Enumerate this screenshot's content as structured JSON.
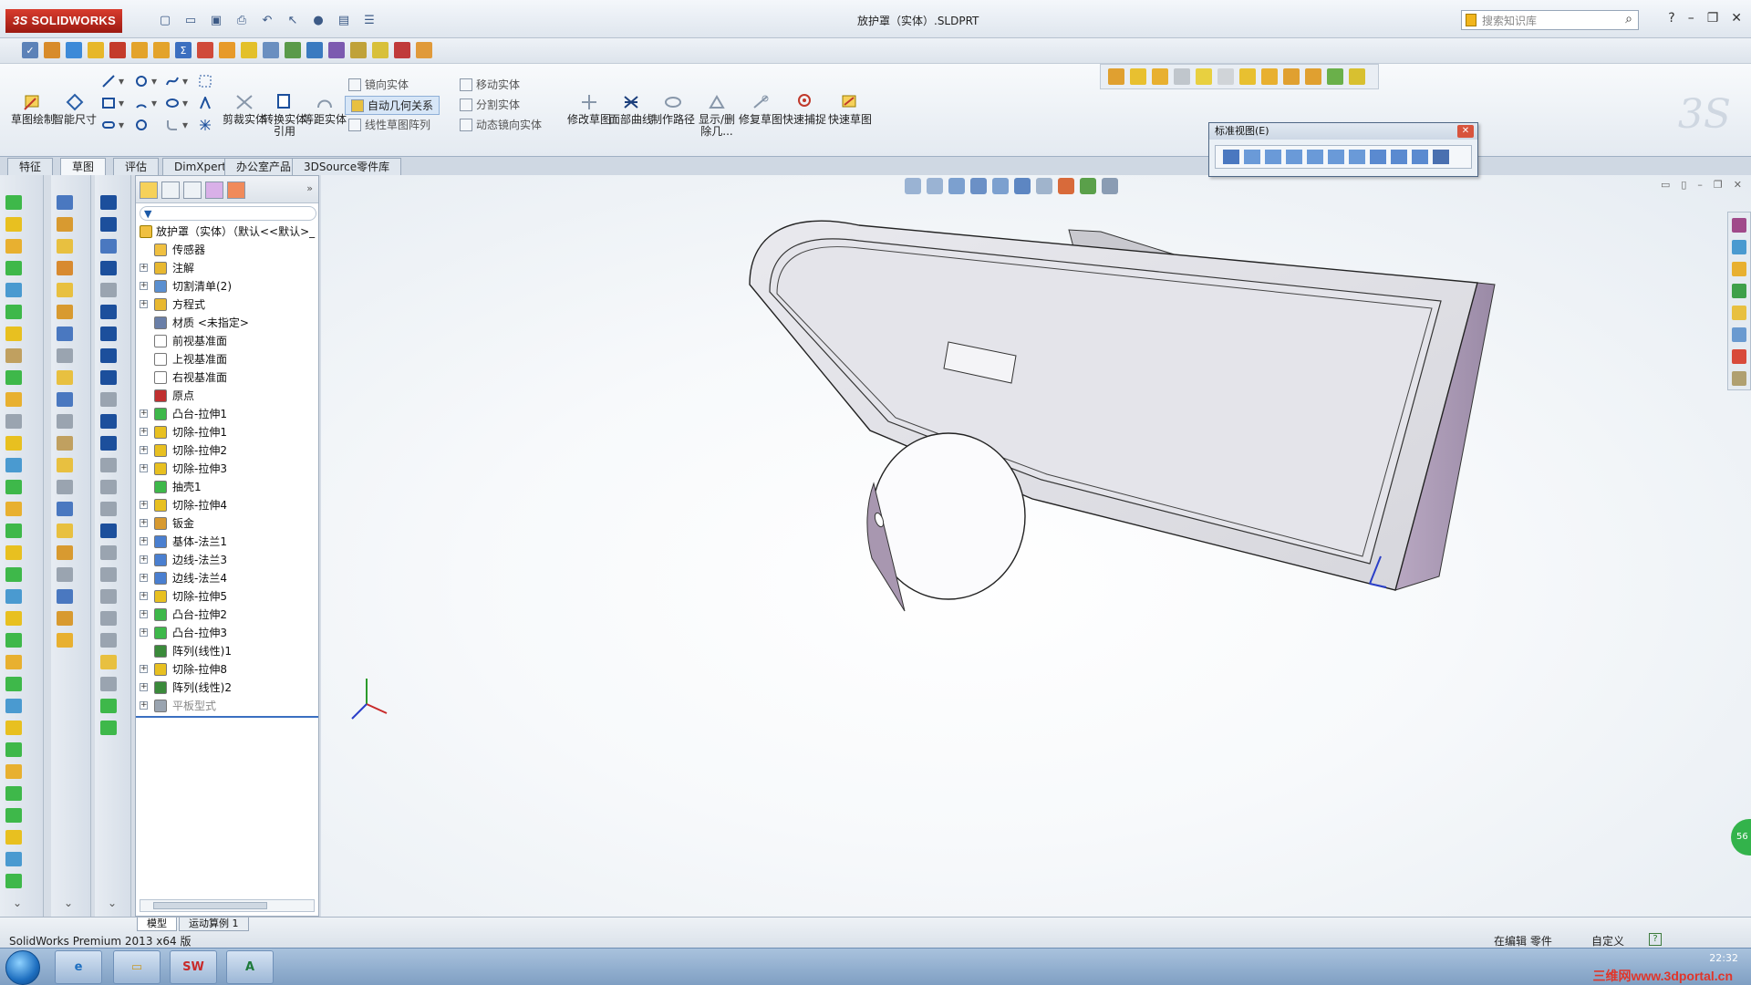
{
  "titlebar": {
    "logo": "SOLIDWORKS",
    "document_title": "放护罩（实体）.SLDPRT",
    "search_placeholder": "搜索知识库",
    "help": "?"
  },
  "command_manager": {
    "big_commands": [
      "草图绘制",
      "智能尺寸",
      "剪裁实体",
      "转换实体引用",
      "等距实体",
      "修改草图",
      "面部曲线",
      "制作路径",
      "显示/删除几...",
      "修复草图",
      "快速捕捉",
      "快速草图"
    ],
    "small_commands": {
      "mirror": "镜向实体",
      "auto_relations": "自动几何关系",
      "linear_pattern": "线性草图阵列",
      "move": "移动实体",
      "split": "分割实体",
      "dynamic_mirror": "动态镜向实体"
    }
  },
  "tabs": [
    "特征",
    "草图",
    "评估",
    "DimXpert",
    "办公室产品",
    "3DSource零件库"
  ],
  "active_tab": "草图",
  "feature_tree": {
    "root": "放护罩（实体）（默认<<默认>_",
    "items": [
      {
        "label": "传感器",
        "expandable": false,
        "color": "#f0c040"
      },
      {
        "label": "注解",
        "expandable": true,
        "color": "#e8b830"
      },
      {
        "label": "切割清单(2)",
        "expandable": true,
        "color": "#5a8fd0"
      },
      {
        "label": "方程式",
        "expandable": true,
        "color": "#e8b830"
      },
      {
        "label": "材质 <未指定>",
        "expandable": false,
        "color": "#6a7fa8"
      },
      {
        "label": "前视基准面",
        "expandable": false,
        "color": "#ffffff"
      },
      {
        "label": "上视基准面",
        "expandable": false,
        "color": "#ffffff"
      },
      {
        "label": "右视基准面",
        "expandable": false,
        "color": "#ffffff"
      },
      {
        "label": "原点",
        "expandable": false,
        "color": "#c03030"
      },
      {
        "label": "凸台-拉伸1",
        "expandable": true,
        "color": "#3eb84a"
      },
      {
        "label": "切除-拉伸1",
        "expandable": true,
        "color": "#e8c020"
      },
      {
        "label": "切除-拉伸2",
        "expandable": true,
        "color": "#e8c020"
      },
      {
        "label": "切除-拉伸3",
        "expandable": true,
        "color": "#e8c020"
      },
      {
        "label": "抽壳1",
        "expandable": false,
        "color": "#3eb84a"
      },
      {
        "label": "切除-拉伸4",
        "expandable": true,
        "color": "#e8c020"
      },
      {
        "label": "钣金",
        "expandable": true,
        "color": "#d89a30"
      },
      {
        "label": "基体-法兰1",
        "expandable": true,
        "color": "#4a7fd0"
      },
      {
        "label": "边线-法兰3",
        "expandable": true,
        "color": "#4a7fd0"
      },
      {
        "label": "边线-法兰4",
        "expandable": true,
        "color": "#4a7fd0"
      },
      {
        "label": "切除-拉伸5",
        "expandable": true,
        "color": "#e8c020"
      },
      {
        "label": "凸台-拉伸2",
        "expandable": true,
        "color": "#3eb84a"
      },
      {
        "label": "凸台-拉伸3",
        "expandable": true,
        "color": "#3eb84a"
      },
      {
        "label": "阵列(线性)1",
        "expandable": false,
        "color": "#3a8a3a"
      },
      {
        "label": "切除-拉伸8",
        "expandable": true,
        "color": "#e8c020"
      },
      {
        "label": "阵列(线性)2",
        "expandable": true,
        "color": "#3a8a3a"
      },
      {
        "label": "平板型式",
        "expandable": true,
        "color": "#9aa4b0",
        "muted": true
      }
    ]
  },
  "standard_views": {
    "title": "标准视图(E)"
  },
  "graphics": {
    "side_badge": "56"
  },
  "statusbar": {
    "sheet_tabs": [
      "模型",
      "运动算例 1"
    ],
    "active_sheet": "模型",
    "left": "SolidWorks Premium 2013 x64 版",
    "mode": "在编辑 零件",
    "units": "自定义"
  },
  "taskbar": {
    "time": "22:32",
    "watermark": "三维网www.3dportal.cn"
  }
}
